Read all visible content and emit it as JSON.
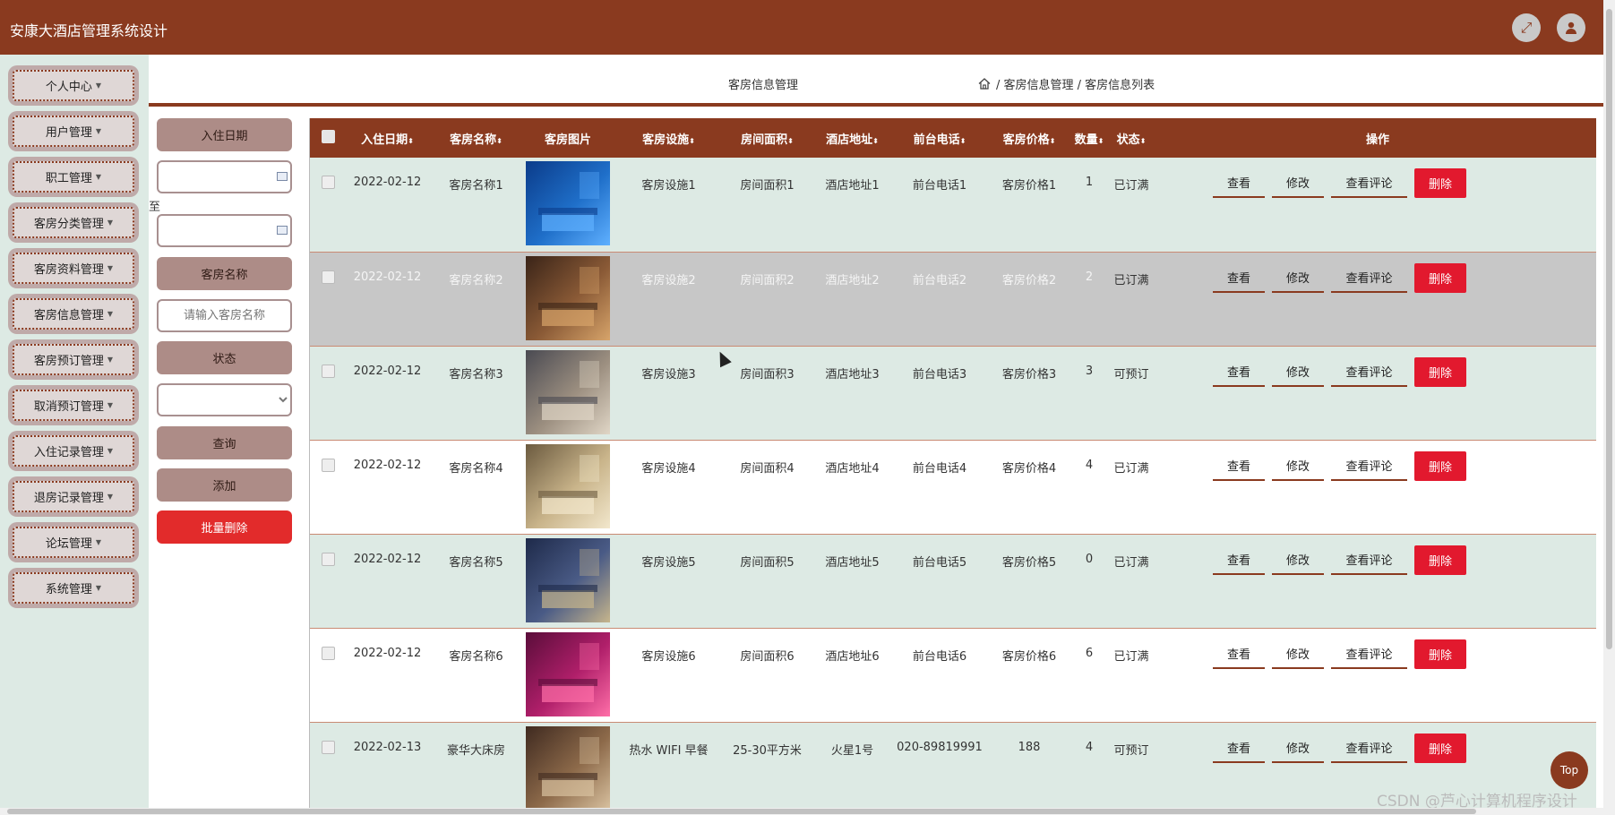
{
  "header": {
    "title": "安康大酒店管理系统设计",
    "fullscreen_icon": "expand-icon",
    "user_icon": "user-icon"
  },
  "sidebar": {
    "items": [
      {
        "label": "个人中心"
      },
      {
        "label": "用户管理"
      },
      {
        "label": "职工管理"
      },
      {
        "label": "客房分类管理"
      },
      {
        "label": "客房资料管理"
      },
      {
        "label": "客房信息管理"
      },
      {
        "label": "客房预订管理"
      },
      {
        "label": "取消预订管理"
      },
      {
        "label": "入住记录管理"
      },
      {
        "label": "退房记录管理"
      },
      {
        "label": "论坛管理"
      },
      {
        "label": "系统管理"
      }
    ]
  },
  "breadcrumb": {
    "page_name": "客房信息管理",
    "trail": "/ 客房信息管理 / 客房信息列表"
  },
  "filter": {
    "date_label": "入住日期",
    "to_text": "至",
    "name_label": "客房名称",
    "name_placeholder": "请输入客房名称",
    "status_label": "状态",
    "status_selected": "",
    "query_label": "查询",
    "add_label": "添加",
    "batch_delete_label": "批量删除"
  },
  "table": {
    "columns": [
      "入住日期",
      "客房名称",
      "客房图片",
      "客房设施",
      "房间面积",
      "酒店地址",
      "前台电话",
      "客房价格",
      "数量",
      "状态",
      "操作"
    ],
    "sortable_mark": "⬍",
    "ops": {
      "view": "查看",
      "edit": "修改",
      "comment": "查看评论",
      "delete": "删除"
    },
    "rows": [
      {
        "date": "2022-02-12",
        "name": "客房名称1",
        "facility": "客房设施1",
        "area": "房间面积1",
        "address": "酒店地址1",
        "phone": "前台电话1",
        "price": "客房价格1",
        "qty": "1",
        "status": "已订满"
      },
      {
        "date": "2022-02-12",
        "name": "客房名称2",
        "facility": "客房设施2",
        "area": "房间面积2",
        "address": "酒店地址2",
        "phone": "前台电话2",
        "price": "客房价格2",
        "qty": "2",
        "status": "已订满"
      },
      {
        "date": "2022-02-12",
        "name": "客房名称3",
        "facility": "客房设施3",
        "area": "房间面积3",
        "address": "酒店地址3",
        "phone": "前台电话3",
        "price": "客房价格3",
        "qty": "3",
        "status": "可预订"
      },
      {
        "date": "2022-02-12",
        "name": "客房名称4",
        "facility": "客房设施4",
        "area": "房间面积4",
        "address": "酒店地址4",
        "phone": "前台电话4",
        "price": "客房价格4",
        "qty": "4",
        "status": "已订满"
      },
      {
        "date": "2022-02-12",
        "name": "客房名称5",
        "facility": "客房设施5",
        "area": "房间面积5",
        "address": "酒店地址5",
        "phone": "前台电话5",
        "price": "客房价格5",
        "qty": "0",
        "status": "已订满"
      },
      {
        "date": "2022-02-12",
        "name": "客房名称6",
        "facility": "客房设施6",
        "area": "房间面积6",
        "address": "酒店地址6",
        "phone": "前台电话6",
        "price": "客房价格6",
        "qty": "6",
        "status": "已订满"
      },
      {
        "date": "2022-02-13",
        "name": "豪华大床房",
        "facility": "热水 WIFI 早餐",
        "area": "25-30平方米",
        "address": "火星1号",
        "phone": "020-89819991",
        "price": "188",
        "qty": "4",
        "status": "可预订"
      }
    ]
  },
  "misc": {
    "top_label": "Top",
    "watermark": "CSDN @芦心计算机程序设计"
  },
  "colors": {
    "brand": "#8a3a1f",
    "danger": "#e2192e",
    "sidebar_bg": "#ddeae4"
  }
}
